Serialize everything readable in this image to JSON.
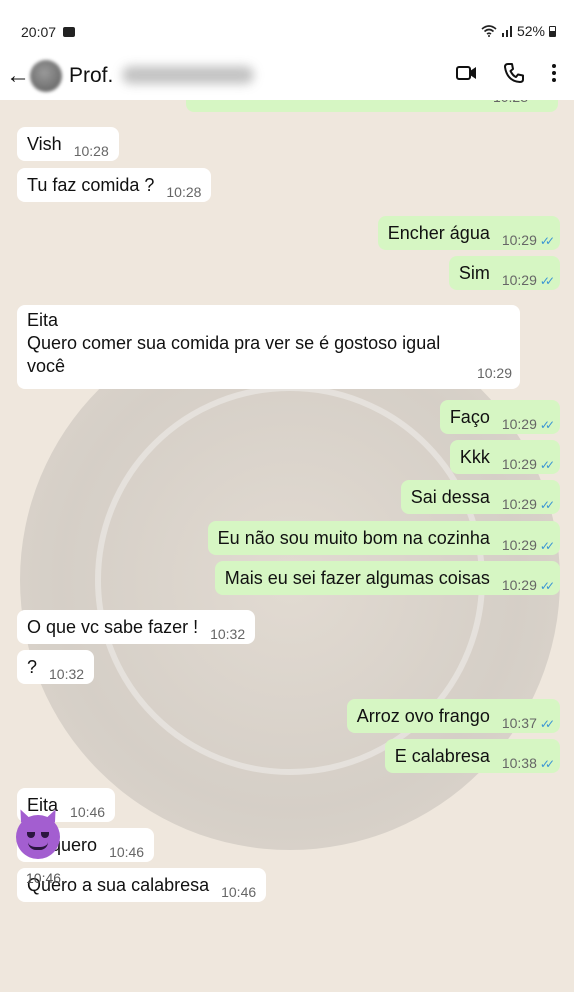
{
  "status_bar": {
    "time": "20:07",
    "battery": "52%"
  },
  "header": {
    "contact_name": "Prof.",
    "icons": [
      "back-arrow-icon",
      "video-call-icon",
      "phone-icon",
      "more-options-icon"
    ]
  },
  "chat": {
    "partial_top": {
      "time": "10:28"
    },
    "messages": [
      {
        "dir": "in",
        "text": "Vish",
        "time": "10:28"
      },
      {
        "dir": "in",
        "text": "Tu faz comida ?",
        "time": "10:28"
      },
      {
        "dir": "out",
        "text": "Encher água",
        "time": "10:29"
      },
      {
        "dir": "out",
        "text": "Sim",
        "time": "10:29"
      },
      {
        "dir": "in",
        "lines": [
          "Eita",
          "Quero comer sua comida pra ver se é gostoso igual",
          "você"
        ],
        "time": "10:29"
      },
      {
        "dir": "out",
        "text": "Faço",
        "time": "10:29"
      },
      {
        "dir": "out",
        "text": "Kkk",
        "time": "10:29"
      },
      {
        "dir": "out",
        "text": "Sai dessa",
        "time": "10:29"
      },
      {
        "dir": "out",
        "text": "Eu não sou muito bom na cozinha",
        "time": "10:29"
      },
      {
        "dir": "out",
        "text": "Mais eu sei fazer algumas coisas",
        "time": "10:29"
      },
      {
        "dir": "in",
        "text": "O que vc sabe fazer !",
        "time": "10:32"
      },
      {
        "dir": "in",
        "text": "?",
        "time": "10:32"
      },
      {
        "dir": "out",
        "text": "Arroz ovo frango",
        "time": "10:37"
      },
      {
        "dir": "out",
        "text": "E calabresa",
        "time": "10:38"
      },
      {
        "dir": "in",
        "text": "Eita",
        "time": "10:46"
      },
      {
        "dir": "in",
        "text": "Já quero",
        "time": "10:46"
      },
      {
        "dir": "in",
        "text": "Quero a sua calabresa",
        "time": "10:46"
      }
    ],
    "emoji_message": {
      "emoji": "smiling-devil-emoji",
      "time": "10:46"
    }
  },
  "colors": {
    "incoming_bubble": "#ffffff",
    "outgoing_bubble": "#d6f6c3",
    "read_ticks": "#3a95d4",
    "chat_background": "#efe7dd"
  }
}
